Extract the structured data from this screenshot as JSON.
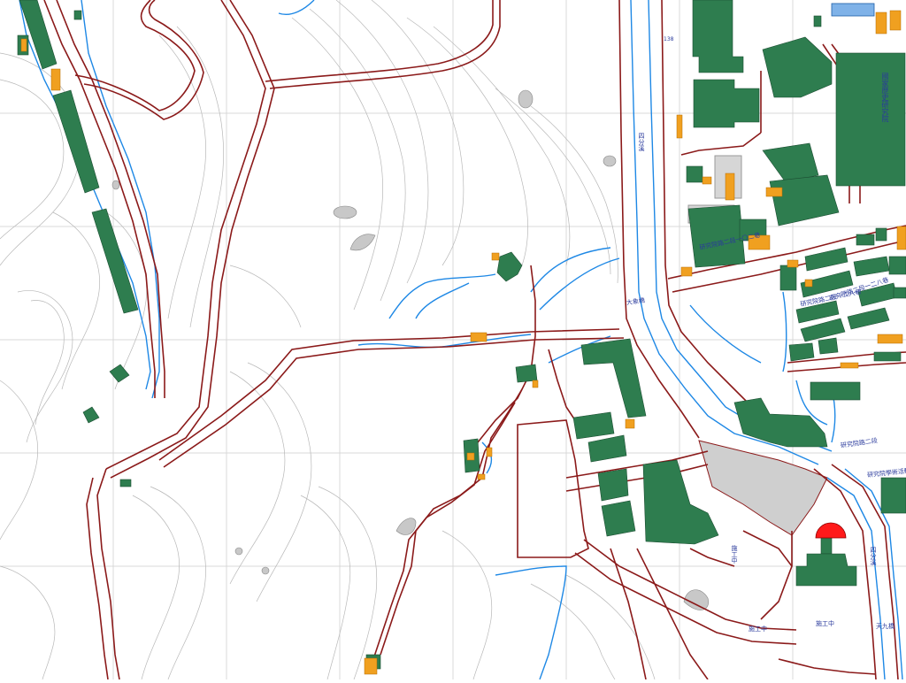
{
  "map": {
    "colors": {
      "road": "#8b1a1a",
      "water": "#1e88e5",
      "building": "#2e7d4f",
      "annex": "#f0a020",
      "paved": "#c8c8c8",
      "contour": "#b8b8b8",
      "grid": "#d9d9d9",
      "marker": "#ff1a1a",
      "label": "#2a3a9c"
    },
    "labels": {
      "stream_north": "四分溪",
      "stream_south": "四分溪",
      "national_museum": "國家歷史研究院",
      "research_road_lane_122": "研究院路二段一〇二巷",
      "research_road_lane_128": "研究院路二段一二八巷",
      "research_road_main": "研究院路二段一二八巷",
      "research_road_side": "研究院路二段",
      "academia_sinica": "研究院學術活動中心",
      "bridge": "大象橋",
      "construction_1": "施工中",
      "construction_2": "施工中",
      "construction_3": "施工中",
      "old_bridge": "天九橋",
      "elevation": "138"
    }
  }
}
